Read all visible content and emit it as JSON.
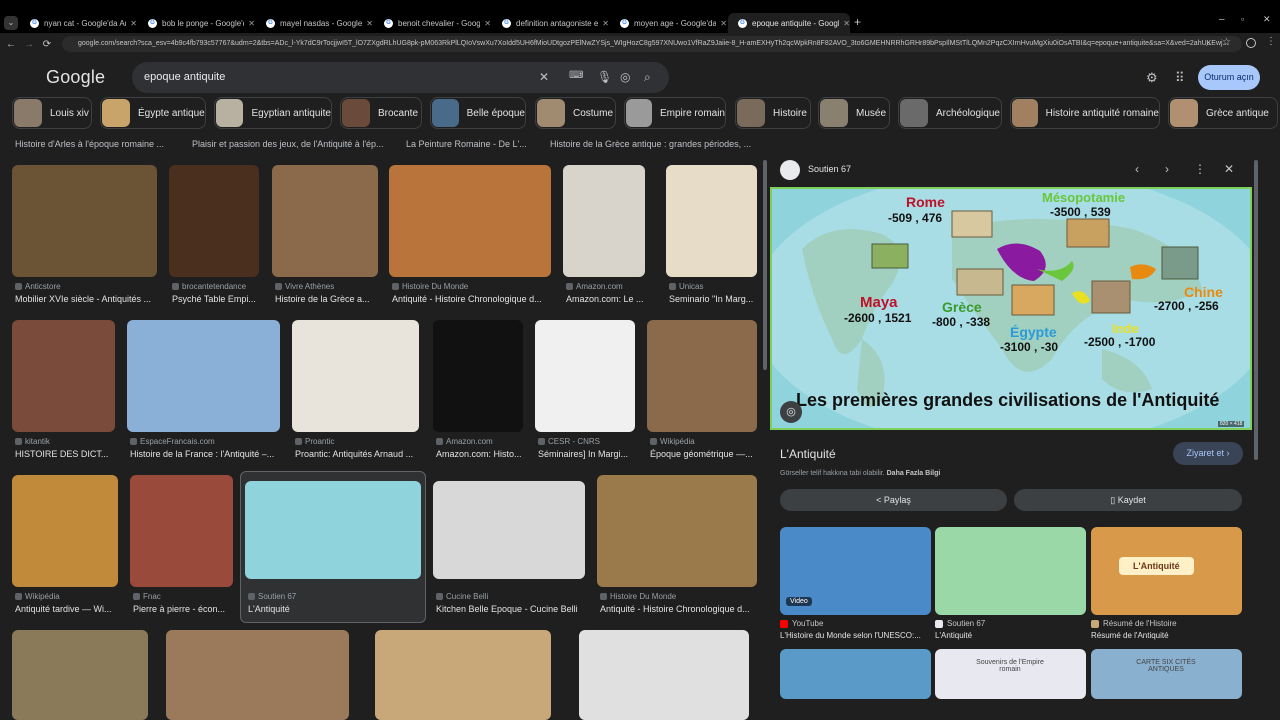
{
  "browser": {
    "tabs": [
      {
        "label": "nyan cat - Google'da Ara"
      },
      {
        "label": "bob le ponge - Google'da Ara"
      },
      {
        "label": "mayel nasdas - Google'da Ara"
      },
      {
        "label": "benoit chevalier - Google'da A"
      },
      {
        "label": "definition antagoniste en franc"
      },
      {
        "label": "moyen age - Google'da Ara"
      },
      {
        "label": "epoque antiquite - Google'da A"
      }
    ],
    "url": "google.com/search?sca_esv=4b9c4fb793c57767&udm=2&tbs=ADc_l-Yk7dC9rTocjjwI5T_lO7ZXgdRLhUG8pk-pM063RkPlLQIoVswXu7XoIdd5UH6fMioUDtgozPElNwZYSjs_WIgHozC8g597XNUwo1VfRaZ9Jaiie-8_H-amEXHyTh2qcWpkRn8F82AVO_3to6GMEHNRRhGRHr89bPspIlMStTlLQMn2PqzCXIrnHvuMgXiu0iOsATBI&q=epoque+antiquite&sa=X&ved=2ahUKEwj..."
  },
  "google": {
    "logo": "Google",
    "query": "epoque antiquite",
    "signin": "Oturum açın"
  },
  "chips": [
    {
      "label": "Louis xiv",
      "color": "#8a7a6a"
    },
    {
      "label": "Égypte antique",
      "color": "#c9a46a"
    },
    {
      "label": "Egyptian antiquite",
      "color": "#b8b0a0"
    },
    {
      "label": "Brocante",
      "color": "#6a4a3a"
    },
    {
      "label": "Belle époque",
      "color": "#4a6a8a"
    },
    {
      "label": "Costume",
      "color": "#a08a70"
    },
    {
      "label": "Empire romain",
      "color": "#9a9a9a"
    },
    {
      "label": "Histoire",
      "color": "#7a6a5a"
    },
    {
      "label": "Musée",
      "color": "#8a8070"
    },
    {
      "label": "Archéologique",
      "color": "#6a6a6a"
    },
    {
      "label": "Histoire antiquité romaine",
      "color": "#a08060"
    },
    {
      "label": "Grèce antique",
      "color": "#b09070"
    }
  ],
  "top_captions": [
    "Histoire d'Arles à l'époque romaine ...",
    "Plaisir et passion des jeux, de l'Antiquité à l'ép...",
    "La Peinture Romaine - De L'...",
    "Histoire de la Grèce antique : grandes périodes, ..."
  ],
  "results": [
    {
      "source": "Anticstore",
      "title": "Mobilier XVIe siècle - Antiquités ...",
      "color": "#6b5336"
    },
    {
      "source": "brocantetendance",
      "title": "Psyché Table Empi...",
      "color": "#4a2e1e"
    },
    {
      "source": "Vivre Athènes",
      "title": "Histoire de la Grèce a...",
      "color": "#8a6a4a"
    },
    {
      "source": "Histoire Du Monde",
      "title": "Antiquité - Histoire Chronologique d...",
      "color": "#b8743a"
    },
    {
      "source": "Amazon.com",
      "title": "Amazon.com: Le ...",
      "color": "#d8d4cc"
    },
    {
      "source": "Unicas",
      "title": "Seminario \"In Marg...",
      "color": "#e6dcc8"
    },
    {
      "source": "kitantik",
      "title": "HISTOIRE DES DICT...",
      "color": "#7a4a3a"
    },
    {
      "source": "EspaceFrancais.com",
      "title": "Histoire de la France : l'Antiquité –...",
      "color": "#8ab0d8"
    },
    {
      "source": "Proantic",
      "title": "Proantic: Antiquités Arnaud ...",
      "color": "#e8e4dc"
    },
    {
      "source": "Amazon.com",
      "title": "Amazon.com: Histo...",
      "color": "#111111"
    },
    {
      "source": "CESR - CNRS",
      "title": "Séminaires] In Margi...",
      "color": "#f0f0f0"
    },
    {
      "source": "Wikipédia",
      "title": "Époque géométrique —...",
      "color": "#8a6a4a"
    },
    {
      "source": "Wikipédia",
      "title": "Antiquité tardive — Wi...",
      "color": "#c08a3a"
    },
    {
      "source": "Fnac",
      "title": "Pierre à pierre - écon...",
      "color": "#9a4a3a"
    },
    {
      "source": "Soutien 67",
      "title": "L'Antiquité",
      "color": "#8fd3dc"
    },
    {
      "source": "Cucine Belli",
      "title": "Kitchen Belle Epoque - Cucine Belli",
      "color": "#d8d8d8"
    },
    {
      "source": "Histoire Du Monde",
      "title": "Antiquité - Histoire Chronologique d...",
      "color": "#9a7a4a"
    }
  ],
  "panel": {
    "site": "Soutien 67",
    "image_title": "Les premières grandes civilisations de l'Antiquité",
    "image_size": "820 × 418",
    "map_labels": [
      {
        "name": "Rome",
        "dates": "-509 , 476",
        "color": "#c0112a"
      },
      {
        "name": "Mésopotamie",
        "dates": "-3500 , 539",
        "color": "#6ac63a"
      },
      {
        "name": "Maya",
        "dates": "-2600 , 1521",
        "color": "#c0112a"
      },
      {
        "name": "Grèce",
        "dates": "-800 , -338",
        "color": "#3a9a2a"
      },
      {
        "name": "Égypte",
        "dates": "-3100 , -30",
        "color": "#2a9ad8"
      },
      {
        "name": "Inde",
        "dates": "-2500 , -1700",
        "color": "#e8e020"
      },
      {
        "name": "Chine",
        "dates": "-2700 , -256",
        "color": "#e88a10"
      }
    ],
    "title": "L'Antiquité",
    "visit": "Ziyaret et",
    "copyright": "Görseller telif hakkına tabi olabilir.",
    "learn_more": "Daha Fazla Bilgi",
    "share": "Paylaş",
    "save": "Kaydet",
    "related": [
      {
        "source": "YouTube",
        "title": "L'Histoire du Monde selon l'UNESCO:...",
        "badge": "Video",
        "color": "#4a8ac8",
        "icon_color": "#ff0000"
      },
      {
        "source": "Soutien 67",
        "title": "L'Antiquité",
        "badge": "",
        "color": "#9ad8a8",
        "icon_color": "#e8eaed"
      },
      {
        "source": "Résumé de l'Histoire",
        "title": "Résumé de l'Antiquité",
        "badge": "L'Antiquité",
        "color": "#d89a4a",
        "icon_color": "#c8a878"
      }
    ],
    "related_row2": [
      {
        "color": "#5a9ac8"
      },
      {
        "color": "#e8e8f0",
        "badge": "Souvenirs de l'Empire romain"
      },
      {
        "color": "#8ab0d0",
        "badge": "CARTE SIX CITÉS ANTIQUES"
      }
    ]
  }
}
